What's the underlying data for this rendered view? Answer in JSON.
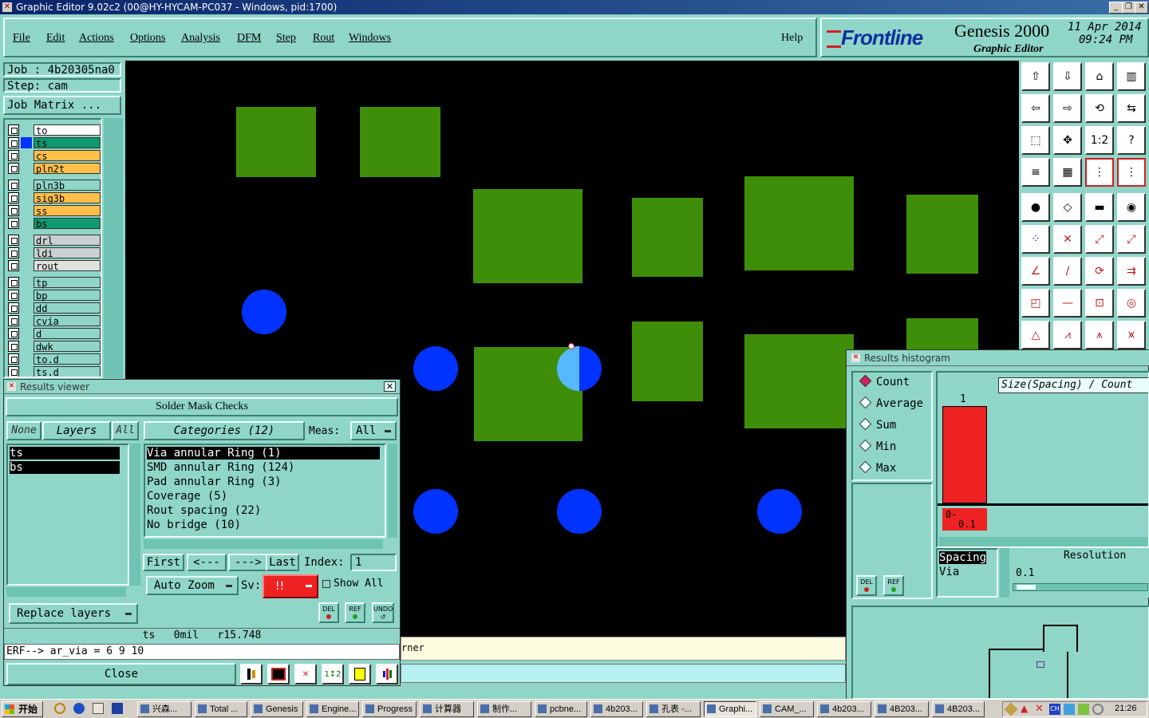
{
  "window": {
    "title": "Graphic Editor 9.02c2 (00@HY-HYCAM-PC037 - Windows, pid:1700)"
  },
  "menu": {
    "items": [
      "File",
      "Edit",
      "Actions",
      "Options",
      "Analysis",
      "DFM",
      "Step",
      "Rout",
      "Windows"
    ],
    "help": "Help"
  },
  "brand": {
    "logo": "Frontline",
    "product": "Genesis 2000",
    "subtitle": "Graphic Editor",
    "date": "11 Apr 2014",
    "time": "09:24 PM"
  },
  "job": {
    "job_label": "Job : 4b20305na0",
    "step_label": "Step: cam",
    "matrix_button": "Job Matrix ..."
  },
  "layers": [
    {
      "name": "to",
      "color": "#ffffff"
    },
    {
      "name": "ts",
      "color": "#0f9a70",
      "active": true
    },
    {
      "name": "cs",
      "color": "#ffc04a"
    },
    {
      "name": "pln2t",
      "color": "#ffc04a"
    },
    {
      "name": "pln3b",
      "color": "#8fd6c8"
    },
    {
      "name": "sig3b",
      "color": "#ffc04a"
    },
    {
      "name": "ss",
      "color": "#ffc04a"
    },
    {
      "name": "bs",
      "color": "#0f9a70"
    },
    {
      "name": "drl",
      "color": "#c8d0d0"
    },
    {
      "name": "ldi",
      "color": "#c8d0d0"
    },
    {
      "name": "rout",
      "color": "#e0e0e0"
    },
    {
      "name": "tp",
      "color": "#8fd6c8"
    },
    {
      "name": "bp",
      "color": "#8fd6c8"
    },
    {
      "name": "dd",
      "color": "#8fd6c8"
    },
    {
      "name": "cvia",
      "color": "#8fd6c8"
    },
    {
      "name": "d",
      "color": "#8fd6c8"
    },
    {
      "name": "dwk",
      "color": "#8fd6c8"
    },
    {
      "name": "to.d",
      "color": "#8fd6c8"
    },
    {
      "name": "ts.d",
      "color": "#8fd6c8"
    }
  ],
  "results_viewer": {
    "title": "Results viewer",
    "heading": "Solder Mask Checks",
    "none_btn": "None",
    "layers_btn": "Layers",
    "all_btn": "All",
    "layer_list": [
      "ts",
      "bs"
    ],
    "categories_btn": "Categories (12)",
    "meas_label": "Meas:",
    "meas_value": "All",
    "categories": [
      "Via annular Ring (1)",
      "SMD annular Ring (124)",
      "Pad annular Ring (3)",
      "Coverage (5)",
      "Rout spacing (22)",
      "No bridge (10)"
    ],
    "first_btn": "First",
    "prev_btn": "<---",
    "next_btn": "--->",
    "last_btn": "Last",
    "index_label": "Index:",
    "index_value": "1",
    "auto_zoom": "Auto Zoom",
    "sv_label": "Sv:",
    "sv_value": "!!",
    "show_all": "Show All",
    "replace_layers": "Replace layers",
    "del_label": "DEL",
    "ref_label": "REF",
    "undo_label": "UNDO",
    "status": "ts   0mil   r15.748",
    "erf": "ERF--> ar_via = 6 9 10",
    "close_btn": "Close"
  },
  "histogram": {
    "title": "Results histogram",
    "options": [
      "Count",
      "Average",
      "Sum",
      "Min",
      "Max"
    ],
    "selected": "Count",
    "header": "Size(Spacing) / Count",
    "bar_count": "1",
    "bin_label": "0-",
    "bin_label2": "0.1",
    "del_label": "DEL",
    "ref_label": "REF",
    "list_items": [
      "Spacing",
      "Via"
    ],
    "resolution_label": "Resolution",
    "resolution_value": "0.1"
  },
  "canvas_msg": "rner",
  "taskbar": {
    "start": "开始",
    "tasks": [
      "兴森...",
      "Total ...",
      "Genesis",
      "Engine...",
      "Progress",
      "计算器",
      "制作...",
      "pcbne...",
      "4b203...",
      "孔表 -...",
      "Graphi...",
      "CAM_...",
      "4b203...",
      "4B203...",
      "4B203..."
    ],
    "active_task": "Graphi...",
    "clock": "21:26"
  },
  "colors": {
    "pad_green": "#3e8e0a",
    "via_blue": "#0033ff",
    "highlight": "#58b8ff",
    "panel": "#8fd6c8",
    "sv_red": "#ee2222",
    "hist_bar": "#ee2222"
  }
}
